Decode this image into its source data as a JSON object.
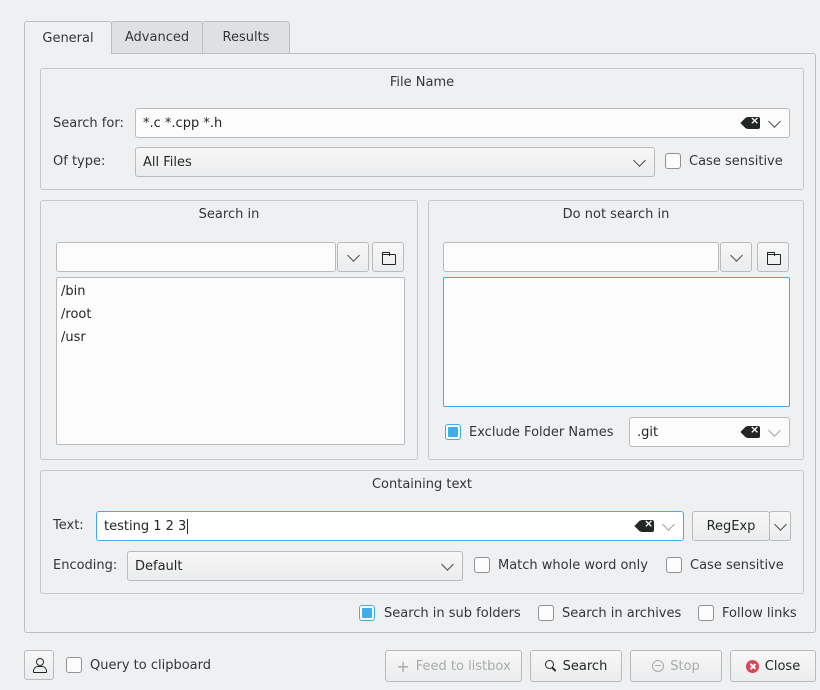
{
  "tabs": [
    {
      "label": "General",
      "active": true
    },
    {
      "label": "Advanced",
      "active": false
    },
    {
      "label": "Results",
      "active": false
    }
  ],
  "file_name": {
    "title": "File Name",
    "search_for_label": "Search for:",
    "search_for_value": "*.c *.cpp *.h",
    "of_type_label": "Of type:",
    "of_type_value": "All Files",
    "case_sensitive_label": "Case sensitive",
    "case_sensitive_checked": false
  },
  "search_in": {
    "title": "Search in",
    "path_value": "",
    "folders": [
      "/bin",
      "/root",
      "/usr"
    ]
  },
  "do_not_search_in": {
    "title": "Do not search in",
    "path_value": "",
    "folders": [],
    "exclude_label": "Exclude Folder Names",
    "exclude_checked": true,
    "exclude_value": ".git"
  },
  "containing_text": {
    "title": "Containing text",
    "text_label": "Text:",
    "text_value": "testing 1 2 3",
    "regexp_label": "RegExp",
    "encoding_label": "Encoding:",
    "encoding_value": "Default",
    "whole_word_label": "Match whole word only",
    "whole_word_checked": false,
    "case_sensitive_label": "Case sensitive",
    "case_sensitive_checked": false
  },
  "options": {
    "sub_folders_label": "Search in sub folders",
    "sub_folders_checked": true,
    "archives_label": "Search in archives",
    "archives_checked": false,
    "follow_links_label": "Follow links",
    "follow_links_checked": false
  },
  "bottom": {
    "query_clipboard_label": "Query to clipboard",
    "feed_label": "Feed to listbox",
    "search_label": "Search",
    "stop_label": "Stop",
    "close_label": "Close"
  },
  "colors": {
    "accent": "#3daee9",
    "window_bg": "#eff0f1",
    "close_red": "#da4453"
  }
}
